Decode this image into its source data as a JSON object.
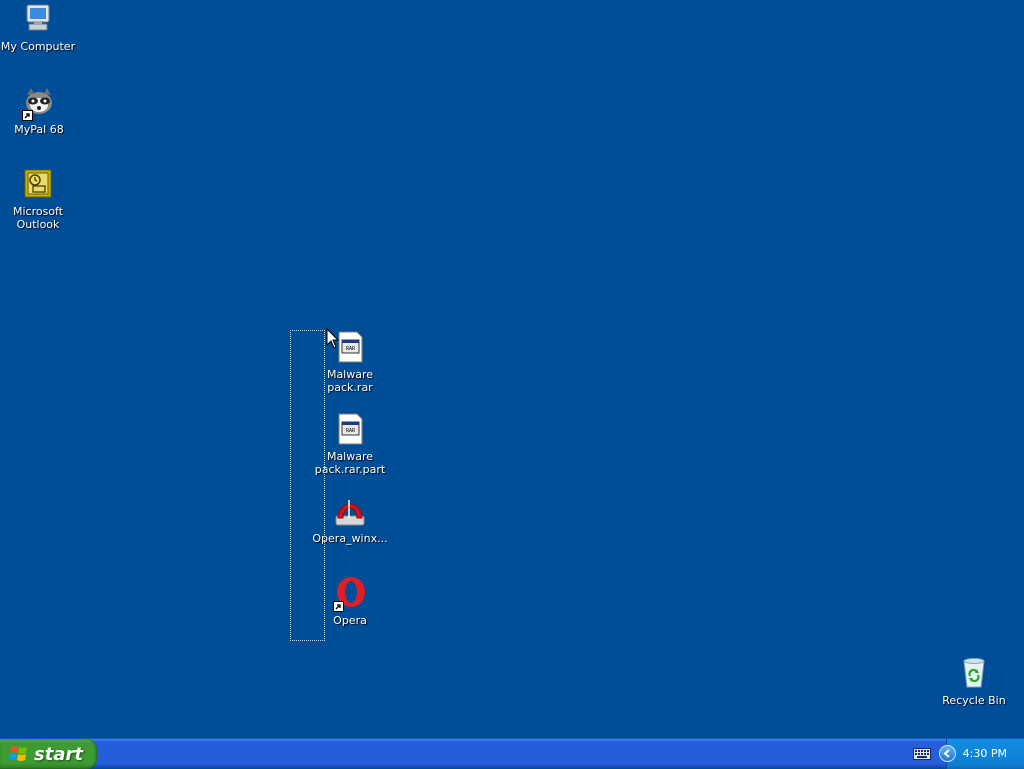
{
  "desktop": {
    "icons": [
      {
        "label": "My Computer",
        "icon": "my-computer-icon"
      },
      {
        "label": "MyPal 68",
        "icon": "mypal-icon",
        "shortcut": true
      },
      {
        "label": "Microsoft Outlook",
        "icon": "outlook-icon"
      },
      {
        "label": "Malware pack.rar",
        "icon": "rar-file-icon"
      },
      {
        "label": "Malware pack.rar.part",
        "icon": "rar-part-file-icon"
      },
      {
        "label": "Opera_winx...",
        "icon": "opera-installer-icon"
      },
      {
        "label": "Opera",
        "icon": "opera-icon",
        "shortcut": true
      },
      {
        "label": "Recycle Bin",
        "icon": "recycle-bin-icon"
      }
    ]
  },
  "taskbar": {
    "start_label": "start",
    "clock": "4:30 PM"
  },
  "colors": {
    "desktop_bg": "#004e98",
    "taskbar": "#245edb",
    "start_green": "#3c9b32",
    "tray": "#0f8be0"
  }
}
